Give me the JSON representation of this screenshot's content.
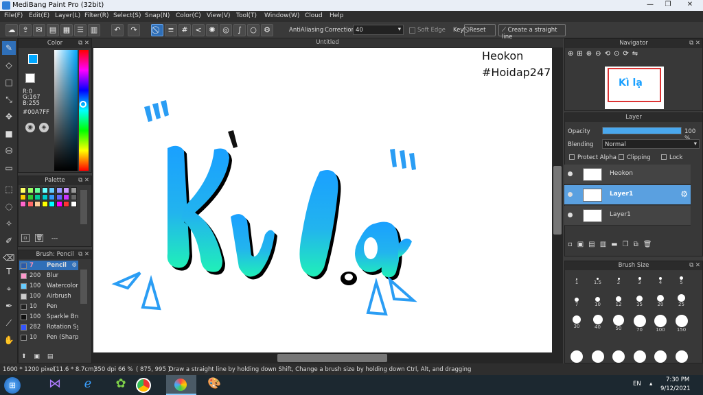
{
  "window": {
    "title": "MediBang Paint Pro (32bit)"
  },
  "menu": [
    "File(F)",
    "Edit(E)",
    "Layer(L)",
    "Filter(R)",
    "Select(S)",
    "Snap(N)",
    "Color(C)",
    "View(V)",
    "Tool(T)",
    "Window(W)",
    "Cloud",
    "Help"
  ],
  "toolbar": {
    "antialiasing_label": "AntiAliasing",
    "correction_label": "Correction",
    "correction_value": "40",
    "soft_edge_label": "Soft Edge",
    "key_label": "Key",
    "reset_label": "Reset",
    "straight_line_label": "Create a straight line"
  },
  "color_panel": {
    "title": "Color",
    "r": "R:0",
    "g": "G:167",
    "b": "B:255",
    "hex": "#00A7FF",
    "primary": "#00A7FF"
  },
  "palette_panel": {
    "title": "Palette",
    "colors": [
      "#ffff66",
      "#99ff66",
      "#66ff99",
      "#66ffff",
      "#66ccff",
      "#9999ff",
      "#cc99ff",
      "#999999",
      "#ffcc00",
      "#33cc33",
      "#00cc99",
      "#00cccc",
      "#3399ff",
      "#6666ff",
      "#cc33ff",
      "#666666",
      "#ff66cc",
      "#ff6666",
      "#ffcc99",
      "#ffff00",
      "#00ffff",
      "#ff00ff",
      "#ff3333",
      "#ffffff"
    ],
    "dash": "---"
  },
  "brush_panel": {
    "title": "Brush: Pencil",
    "brushes": [
      {
        "size": "7",
        "name": "Pencil",
        "color": "#2a5aa8"
      },
      {
        "size": "200",
        "name": "Blur",
        "color": "#ff99cc"
      },
      {
        "size": "100",
        "name": "Watercolor",
        "color": "#66ccff"
      },
      {
        "size": "100",
        "name": "Airbrush",
        "color": "#cccccc"
      },
      {
        "size": "10",
        "name": "Pen",
        "color": "#222222"
      },
      {
        "size": "100",
        "name": "Sparkle Bru",
        "color": "#111111"
      },
      {
        "size": "282",
        "name": "Rotation Sy",
        "color": "#3355ff"
      },
      {
        "size": "10",
        "name": "Pen (Sharp",
        "color": "#222222"
      }
    ]
  },
  "document": {
    "title": "Untitled",
    "watermark_line1": "Heokon",
    "watermark_line2": "#Hoidap247",
    "art_text_1": "Kì",
    "art_text_2": "lạ"
  },
  "navigator": {
    "title": "Navigator"
  },
  "layer_panel": {
    "title": "Layer",
    "opacity_label": "Opacity",
    "opacity_value": "100 %",
    "opacity_fraction": 1.0,
    "blending_label": "Blending",
    "blending_value": "Normal",
    "protect_alpha": "Protect Alpha",
    "clipping": "Clipping",
    "lock": "Lock",
    "layers": [
      {
        "name": "Heokon"
      },
      {
        "name": "Layer1"
      },
      {
        "name": "Layer1"
      }
    ]
  },
  "brush_size_panel": {
    "title": "Brush Size",
    "sizes": [
      "1",
      "1.5",
      "2",
      "3",
      "4",
      "5",
      "7",
      "10",
      "12",
      "15",
      "20",
      "25",
      "30",
      "40",
      "50",
      "70",
      "100",
      "150"
    ]
  },
  "status": {
    "dimensions": "1600 * 1200 pixel",
    "physical": "(11.6 * 8.7cm)",
    "dpi": "350 dpi",
    "zoom": "66 %",
    "coords": "( 875, 995 )",
    "hint": "Draw a straight line by holding down Shift, Change a brush size by holding down Ctrl, Alt, and dragging"
  },
  "taskbar": {
    "lang": "EN",
    "time": "7:30 PM",
    "date": "9/12/2021"
  }
}
